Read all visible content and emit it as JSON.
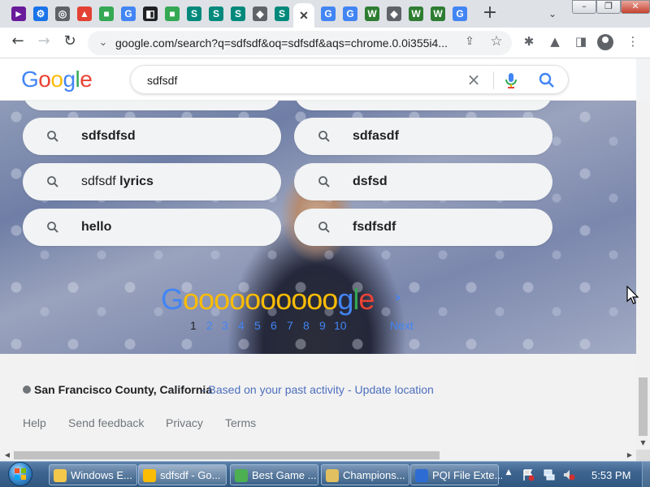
{
  "browser": {
    "tabs": [
      {
        "name": "tab-1",
        "color": "#6a1b9a",
        "glyph": "►"
      },
      {
        "name": "tab-2",
        "color": "#1a73e8",
        "glyph": "⚙"
      },
      {
        "name": "tab-3",
        "color": "#5f6368",
        "glyph": "◎"
      },
      {
        "name": "tab-4",
        "color": "#e34133",
        "glyph": "▲"
      },
      {
        "name": "tab-5",
        "color": "#34a853",
        "glyph": "■"
      },
      {
        "name": "tab-6",
        "color": "#4285f4",
        "glyph": "G"
      },
      {
        "name": "tab-7",
        "color": "#202124",
        "glyph": "◧"
      },
      {
        "name": "tab-8",
        "color": "#34a853",
        "glyph": "■"
      },
      {
        "name": "tab-9",
        "color": "#00897b",
        "glyph": "S"
      },
      {
        "name": "tab-10",
        "color": "#00897b",
        "glyph": "S"
      },
      {
        "name": "tab-11",
        "color": "#00897b",
        "glyph": "S"
      },
      {
        "name": "tab-12",
        "color": "#5f6368",
        "glyph": "◆"
      },
      {
        "name": "tab-13",
        "color": "#00897b",
        "glyph": "S"
      },
      {
        "name": "tab-14-active",
        "color": "#ffffff",
        "glyph": "✕"
      },
      {
        "name": "tab-15",
        "color": "#4285f4",
        "glyph": "G"
      },
      {
        "name": "tab-16",
        "color": "#4285f4",
        "glyph": "G"
      },
      {
        "name": "tab-17",
        "color": "#2e7d32",
        "glyph": "W"
      },
      {
        "name": "tab-18",
        "color": "#5f6368",
        "glyph": "◆"
      },
      {
        "name": "tab-19",
        "color": "#2e7d32",
        "glyph": "W"
      },
      {
        "name": "tab-20",
        "color": "#2e7d32",
        "glyph": "W"
      },
      {
        "name": "tab-21",
        "color": "#4285f4",
        "glyph": "G"
      }
    ],
    "new_tab_glyph": "+",
    "tab_menu_glyph": "⌄",
    "window_buttons": {
      "minimize": "–",
      "maximize": "❐",
      "close": "✕"
    },
    "url": "google.com/search?q=sdfsdf&oq=sdfsdf&aqs=chrome.0.0i355i4..."
  },
  "google": {
    "logo_letters": [
      {
        "ch": "G",
        "color": "#4285f4"
      },
      {
        "ch": "o",
        "color": "#ea4335"
      },
      {
        "ch": "o",
        "color": "#fbbc05"
      },
      {
        "ch": "g",
        "color": "#4285f4"
      },
      {
        "ch": "l",
        "color": "#34a853"
      },
      {
        "ch": "e",
        "color": "#ea4335"
      }
    ],
    "search_query": "sdfsdf",
    "related_searches": [
      {
        "name": "related-sdfsdfsd",
        "prefix": "",
        "bold": "sdfsdfsd"
      },
      {
        "name": "related-sdfasdf",
        "prefix": "",
        "bold": "sdfasdf"
      },
      {
        "name": "related-sdfsdf-lyrics",
        "prefix": "sdfsdf ",
        "bold": "lyrics"
      },
      {
        "name": "related-dsfsd",
        "prefix": "",
        "bold": "dsfsd"
      },
      {
        "name": "related-hello",
        "prefix": "",
        "bold": "hello"
      },
      {
        "name": "related-fsdfsdf",
        "prefix": "",
        "bold": "fsdfsdf"
      }
    ],
    "pagination": {
      "current": "1",
      "pages": [
        "2",
        "3",
        "4",
        "5",
        "6",
        "7",
        "8",
        "9",
        "10"
      ],
      "next_label": "Next",
      "next_arrow": "›"
    },
    "footer": {
      "location": "San Francisco County, California",
      "location_link_1": "- Based on your past activity",
      "location_link_2": "- Update location",
      "links": [
        "Help",
        "Send feedback",
        "Privacy",
        "Terms"
      ]
    }
  },
  "taskbar": {
    "tasks": [
      {
        "name": "task-windows-explorer",
        "label": "Windows E...",
        "color": "#f3c84b"
      },
      {
        "name": "task-chrome-sdfsdf",
        "label": "sdfsdf - Go...",
        "color": "#fbbc05"
      },
      {
        "name": "task-best-game",
        "label": "Best Game ...",
        "color": "#4caf50"
      },
      {
        "name": "task-champions",
        "label": "Champions...",
        "color": "#e0c060"
      },
      {
        "name": "task-pqi-file",
        "label": "PQI File Exte...",
        "color": "#2d6cd3"
      }
    ],
    "clock": "5:53 PM"
  }
}
